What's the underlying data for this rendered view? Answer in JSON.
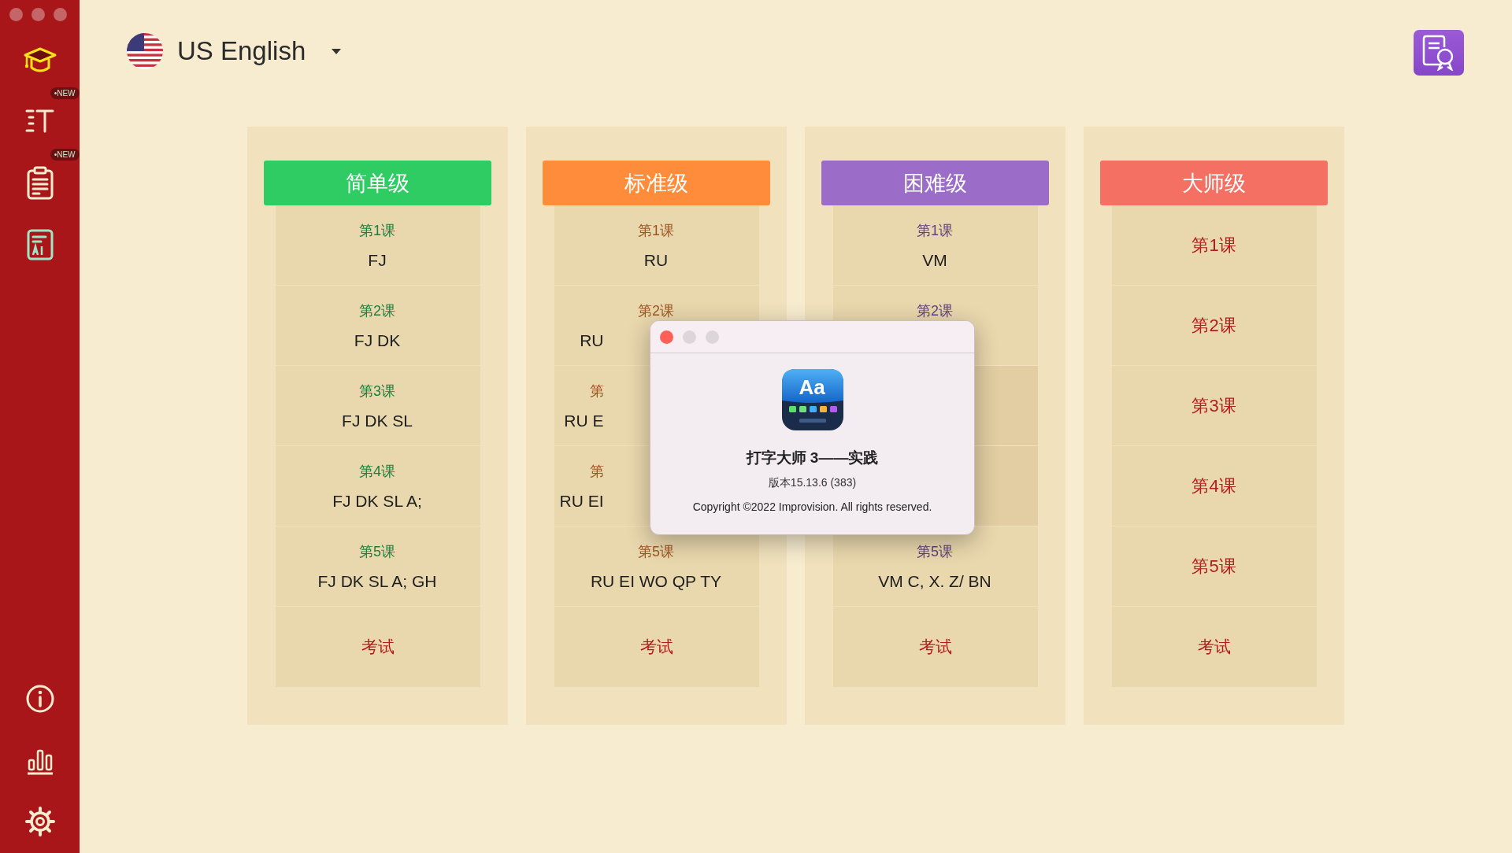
{
  "sidebar": {
    "items": [
      {
        "selected": true
      },
      {
        "selected": false,
        "badge": "•NEW"
      },
      {
        "selected": false,
        "badge": "•NEW"
      },
      {
        "selected": false
      }
    ]
  },
  "language": {
    "label": "US English"
  },
  "levels": [
    {
      "title": "简单级",
      "color": "#2ecc63",
      "lessons": [
        {
          "label": "第1课",
          "keys": "FJ"
        },
        {
          "label": "第2课",
          "keys": "FJ DK"
        },
        {
          "label": "第3课",
          "keys": "FJ DK SL"
        },
        {
          "label": "第4课",
          "keys": "FJ DK SL A;"
        },
        {
          "label": "第5课",
          "keys": "FJ DK SL A; GH"
        }
      ],
      "exam": "考试"
    },
    {
      "title": "标准级",
      "color": "#ff8c3a",
      "lessons": [
        {
          "label": "第1课",
          "keys": "RU"
        },
        {
          "label": "第2课",
          "keys": "RU",
          "keys_cut": true
        },
        {
          "label": "第",
          "label_cut": true,
          "keys": "RU E",
          "keys_cut": true
        },
        {
          "label": "第",
          "label_cut": true,
          "keys": "RU EI",
          "keys_cut": true
        },
        {
          "label": "第5课",
          "keys": "RU EI WO QP TY"
        }
      ],
      "exam": "考试"
    },
    {
      "title": "困难级",
      "color": "#9b6cc8",
      "lessons": [
        {
          "label": "第1课",
          "keys": "VM"
        },
        {
          "label": "第2课"
        },
        {
          "kind": "covered"
        },
        {
          "kind": "covered"
        },
        {
          "label": "第5课",
          "keys": "VM C, X. Z/ BN"
        }
      ],
      "exam": "考试"
    },
    {
      "title": "大师级",
      "color": "#f47062",
      "lessons": [
        {
          "label": "第1课"
        },
        {
          "label": "第2课"
        },
        {
          "label": "第3课"
        },
        {
          "label": "第4课"
        },
        {
          "label": "第5课"
        }
      ],
      "exam": "考试"
    }
  ],
  "about_dialog": {
    "icon_text": "Aa",
    "title": "打字大师 3——实践",
    "version": "版本15.13.6 (383)",
    "copyright": "Copyright ©2022 Improvision. All rights reserved."
  }
}
